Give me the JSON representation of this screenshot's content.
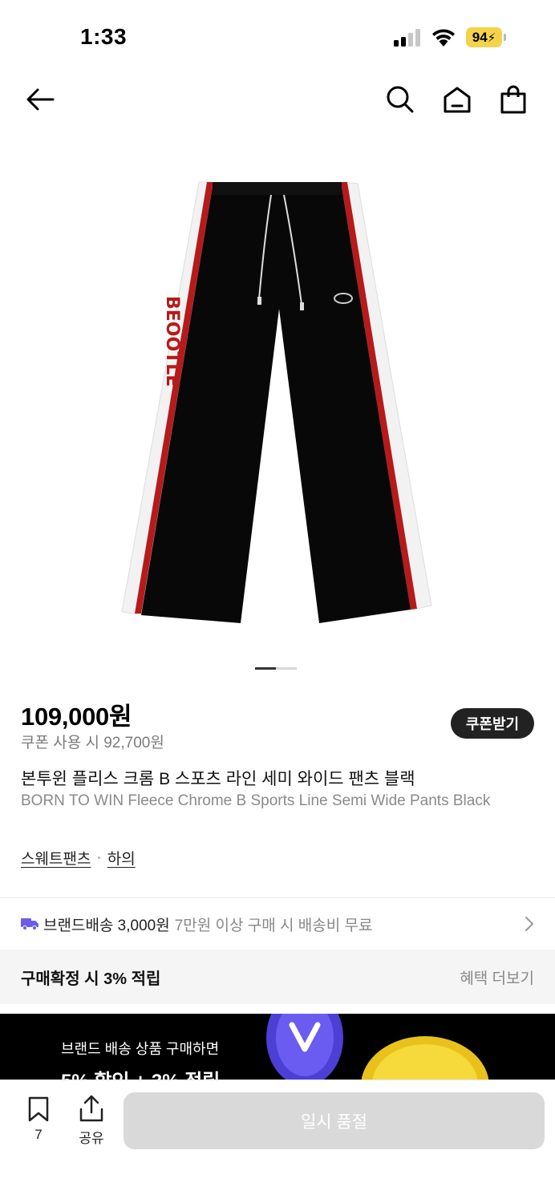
{
  "status_bar": {
    "time": "1:33",
    "battery": "94",
    "icons": [
      "cellular-signal-icon",
      "wifi-icon",
      "battery-charging-icon"
    ]
  },
  "nav": {
    "icons": [
      "back-arrow-icon",
      "search-icon",
      "home-icon",
      "shopping-bag-icon"
    ]
  },
  "product": {
    "image": "black-sweatpants-with-red-white-side-stripes",
    "image_letters": "BEOOTLE",
    "price": "109,000원",
    "coupon_price": "쿠폰 사용 시 92,700원",
    "coupon_button": "쿠폰받기",
    "title_ko": "본투윈 플리스 크롬 B 스포츠 라인 세미 와이드 팬츠 블랙",
    "title_en": "BORN TO WIN Fleece Chrome B Sports Line Semi Wide Pants Black",
    "breadcrumb": [
      "스웨트팬츠",
      "하의"
    ],
    "breadcrumb_sep": "·"
  },
  "image_pager": {
    "total": 2,
    "active": 1
  },
  "shipping": {
    "label": "브랜드배송 3,000원",
    "note": "7만원 이상 구매 시 배송비 무료"
  },
  "benefit": {
    "text": "구매확정 시 3% 적립",
    "more": "혜택 더보기"
  },
  "banner": {
    "line1": "브랜드 배송 상품 구매하면",
    "line2": "5% 할인 + 3% 적립"
  },
  "bottom_bar": {
    "bookmark_count": "7",
    "share_label": "공유",
    "action_button": "일시 품절"
  },
  "colors": {
    "accent_dark": "#222222",
    "disabled_button": "#d9d9d9",
    "truck_icon": "#6c5ce7",
    "battery": "#f4d34a"
  }
}
